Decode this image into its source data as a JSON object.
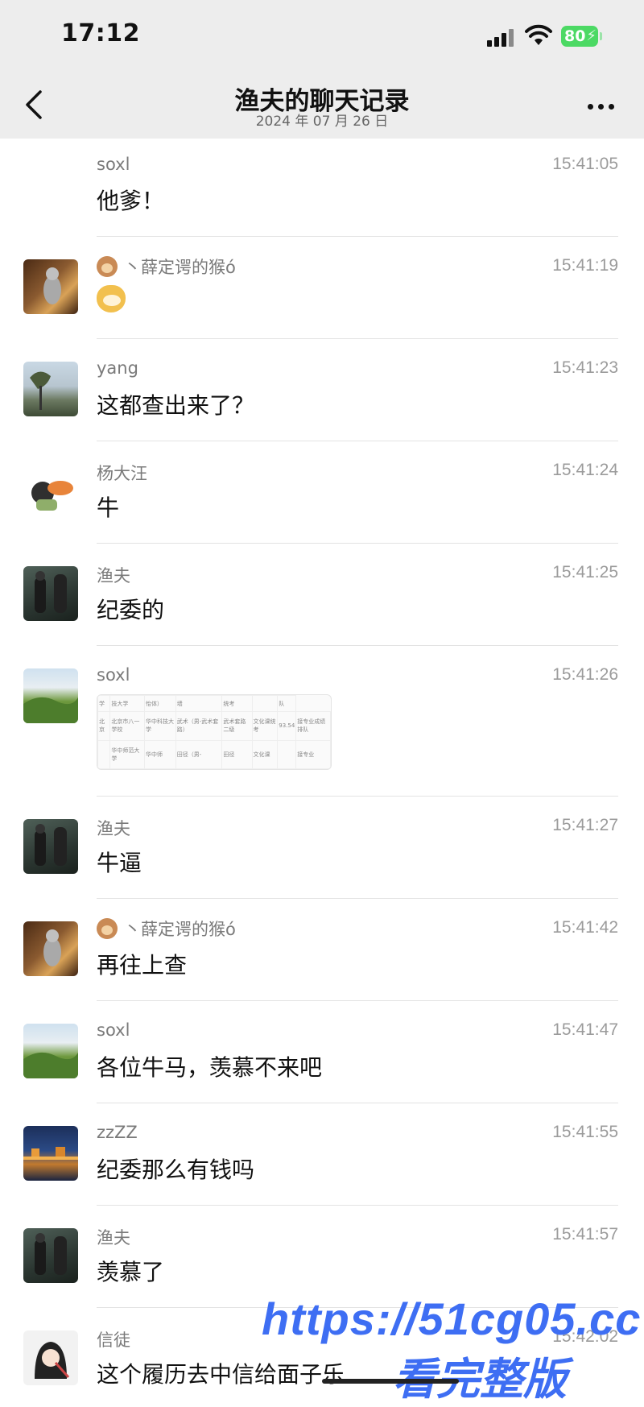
{
  "status_bar": {
    "time": "17:12",
    "battery": "80"
  },
  "nav": {
    "title": "渔夫的聊天记录",
    "subtitle": "2024 年 07 月 26 日"
  },
  "messages": [
    {
      "sender": "soxl",
      "time": "15:41:05",
      "text": "他爹！",
      "avatar": "none"
    },
    {
      "sender": "丶薛定谔的猴ó",
      "time": "15:41:19",
      "text": "",
      "avatar": "room-figure",
      "sticker": "doge-emoji"
    },
    {
      "sender": "yang",
      "time": "15:41:23",
      "text": "这都查出来了？",
      "avatar": "tree-landscape"
    },
    {
      "sender": "杨大汪",
      "time": "15:41:24",
      "text": "牛",
      "avatar": "cartoon-duck"
    },
    {
      "sender": "渔夫",
      "time": "15:41:25",
      "text": "纪委的",
      "avatar": "dark-figures"
    },
    {
      "sender": "soxl",
      "time": "15:41:26",
      "text": "",
      "avatar": "mountain-sky",
      "image": {
        "rows": [
          [
            "学",
            "技大学",
            "怡体）",
            "墙",
            "统考",
            "",
            "队"
          ],
          [
            "北京",
            "北京市八一学校",
            "华中科技大学",
            "武术（男-武术套路）",
            "武术套路二级",
            "文化课统考",
            "93.54",
            "接专业成绩排队"
          ],
          [
            "",
            "华中师范大学",
            "华中师",
            "田径（男-",
            "田径",
            "文化课",
            "",
            "接专业"
          ]
        ]
      }
    },
    {
      "sender": "渔夫",
      "time": "15:41:27",
      "text": "牛逼",
      "avatar": "dark-figures"
    },
    {
      "sender": "丶薛定谔的猴ó",
      "time": "15:41:42",
      "text": "再往上查",
      "avatar": "room-figure"
    },
    {
      "sender": "soxl",
      "time": "15:41:47",
      "text": "各位牛马，羡慕不来吧",
      "avatar": "mountain-sky"
    },
    {
      "sender": "zzZZ",
      "time": "15:41:55",
      "text": "纪委那么有钱吗",
      "avatar": "night-town"
    },
    {
      "sender": "渔夫",
      "time": "15:41:57",
      "text": "羡慕了",
      "avatar": "dark-figures"
    },
    {
      "sender": "信徒",
      "time": "15:42:02",
      "text": "这个履历去中信给面子乐",
      "avatar": "cartoon-girl"
    }
  ],
  "watermark": {
    "url": "https://51cg05.cc",
    "text": "看完整版"
  },
  "colors": {
    "header_bg": "#ededed",
    "watermark": "#3e6ef3",
    "battery": "#4cd964"
  }
}
